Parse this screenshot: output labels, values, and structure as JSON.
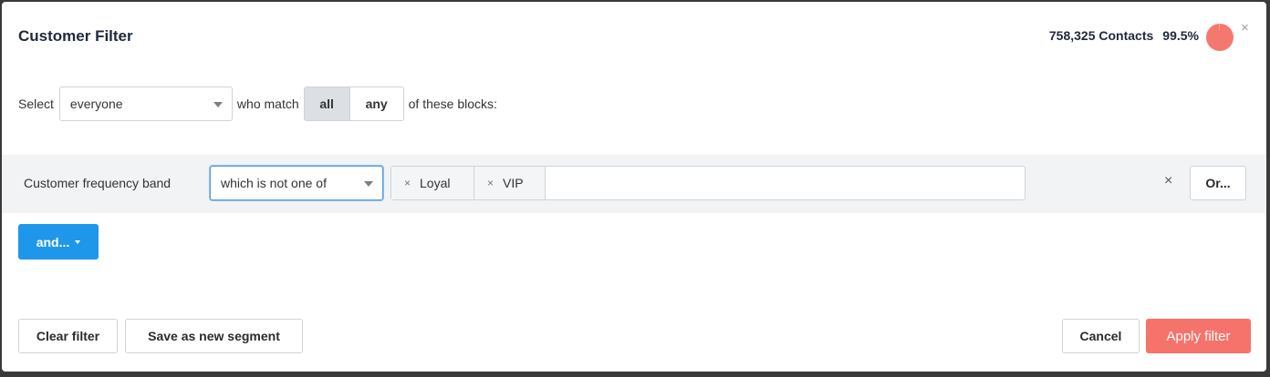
{
  "modal": {
    "title": "Customer Filter",
    "contacts_count": "758,325 Contacts",
    "contacts_percent": "99.5%",
    "percent_value": 99.5,
    "close_icon": "×"
  },
  "selection": {
    "select_label": "Select",
    "audience_value": "everyone",
    "match_label": "who match",
    "match_options": [
      "all",
      "any"
    ],
    "match_selected": "all",
    "blocks_label": "of these blocks:"
  },
  "block": {
    "field_label": "Customer frequency band",
    "operator_value": "which is not one of",
    "tags": [
      "Loyal",
      "VIP"
    ],
    "remove_icon": "×",
    "or_label": "Or..."
  },
  "and_button": {
    "label": "and..."
  },
  "footer": {
    "clear_label": "Clear filter",
    "save_segment_label": "Save as new segment",
    "cancel_label": "Cancel",
    "apply_label": "Apply filter"
  },
  "colors": {
    "accent_blue": "#1e97ea",
    "apply_red": "#f6736b",
    "pie": "#f5786f"
  }
}
